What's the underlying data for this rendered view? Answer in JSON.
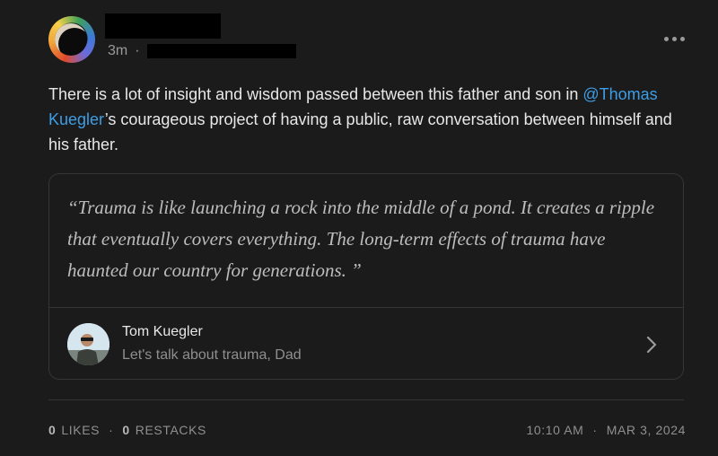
{
  "post": {
    "time_ago": "3m",
    "meta_separator": "·",
    "body_before": "There is a lot of insight and wisdom passed between this father and son in ",
    "mention": "@Thomas Kuegler",
    "body_after": "’s courageous project of having a public, raw conversation between himself and his father."
  },
  "quote_card": {
    "quote": "“Trauma is like launching a rock into the middle of a pond. It creates a ripple that eventually covers everything. The long-term effects of trauma have haunted our country for generations. ”",
    "author_name": "Tom Kuegler",
    "subtitle": "Let's talk about trauma, Dad"
  },
  "footer": {
    "likes_count": "0",
    "likes_label": "LIKES",
    "separator": "·",
    "restacks_count": "0",
    "restacks_label": "RESTACKS",
    "time": "10:10 AM",
    "date": "MAR 3, 2024"
  },
  "icons": {
    "more": "more-horizontal-icon",
    "chevron": "chevron-right-icon"
  },
  "colors": {
    "background": "#1b1b1b",
    "mention": "#3d9ee6",
    "border": "#353535"
  }
}
